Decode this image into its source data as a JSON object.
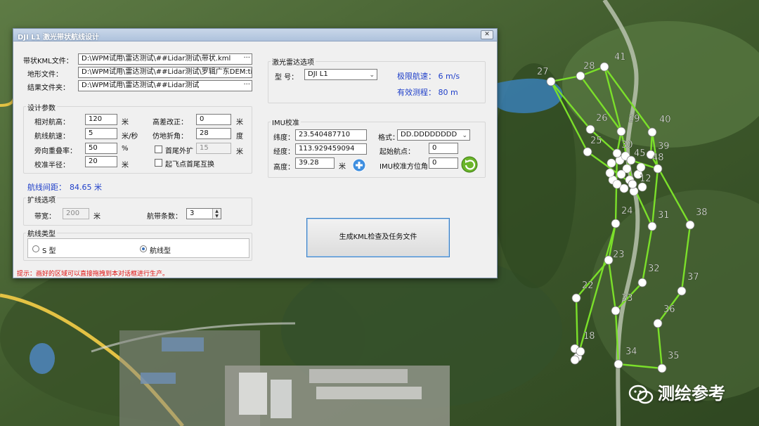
{
  "dialog": {
    "title": "DJI L1 激光带状航线设计",
    "close_glyph": "✕",
    "files": {
      "strip_kml": {
        "label": "带状KML文件：",
        "value": "D:\\WPM试用\\雷达测试\\##Lidar测试\\带状.kml"
      },
      "terrain": {
        "label": "地形文件：",
        "value": "D:\\WPM试用\\雷达测试\\##Lidar测试\\罗辑广东DEM.tif"
      },
      "result_dir": {
        "label": "结果文件夹：",
        "value": "D:\\WPM试用\\雷达测试\\##Lidar测试"
      },
      "browse_glyph": "···"
    },
    "design": {
      "title": "设计参数",
      "rel_alt": {
        "label": "相对航高：",
        "value": "120",
        "unit": "米"
      },
      "speed": {
        "label": "航线航速：",
        "value": "5",
        "unit": "米/秒"
      },
      "side_overlap": {
        "label": "旁向重叠率：",
        "value": "50",
        "unit": "%"
      },
      "calib_radius": {
        "label": "校准半径：",
        "value": "20",
        "unit": "米"
      },
      "height_diff": {
        "label": "高差改正：",
        "value": "0",
        "unit": "米"
      },
      "fold_angle": {
        "label": "仿地折角：",
        "value": "28",
        "unit": "度"
      },
      "tail_extend": {
        "label": "首尾外扩",
        "value": "15",
        "unit": "米"
      },
      "swap_label": "起飞点首尾互换"
    },
    "line_spacing": {
      "label": "航线间距：",
      "value": "84.65 米"
    },
    "expand": {
      "title": "扩线选项",
      "band_width": {
        "label": "带宽：",
        "value": "200",
        "unit": "米"
      },
      "strip_count": {
        "label": "航带条数：",
        "value": "3"
      }
    },
    "route_type": {
      "title": "航线类型",
      "option_s": "S 型",
      "option_route": "航线型"
    },
    "lidar": {
      "title": "激光雷达选项",
      "model_label": "型  号：",
      "model_value": "DJI L1",
      "max_speed": "极限航速：  6 m/s",
      "effective_range": "有效测程：  80 m"
    },
    "imu": {
      "title": "IMU校准",
      "lat": {
        "label": "纬度：",
        "value": "23.540487710"
      },
      "lon": {
        "label": "经度：",
        "value": "113.929459094"
      },
      "alt": {
        "label": "高度：",
        "value": "39.28",
        "unit": "米"
      },
      "format": {
        "label": "格式：",
        "value": "DD.DDDDDDDD"
      },
      "start_wp": {
        "label": "起始航点：",
        "value": "0"
      },
      "heading": {
        "label": "IMU校准方位角：",
        "value": "0"
      }
    },
    "generate_label": "生成KML检查及任务文件",
    "hint": "提示：画好的区域可以直接拖拽到本对话框进行生产。"
  },
  "map": {
    "waypoints": [
      "41",
      "28",
      "27",
      "26",
      "29",
      "40",
      "30",
      "25",
      "39",
      "45",
      "48",
      "12",
      "24",
      "31",
      "38",
      "23",
      "32",
      "37",
      "22",
      "33",
      "36",
      "18",
      "34",
      "35"
    ],
    "route_color": "#7be02a"
  },
  "watermark": "测绘参考"
}
